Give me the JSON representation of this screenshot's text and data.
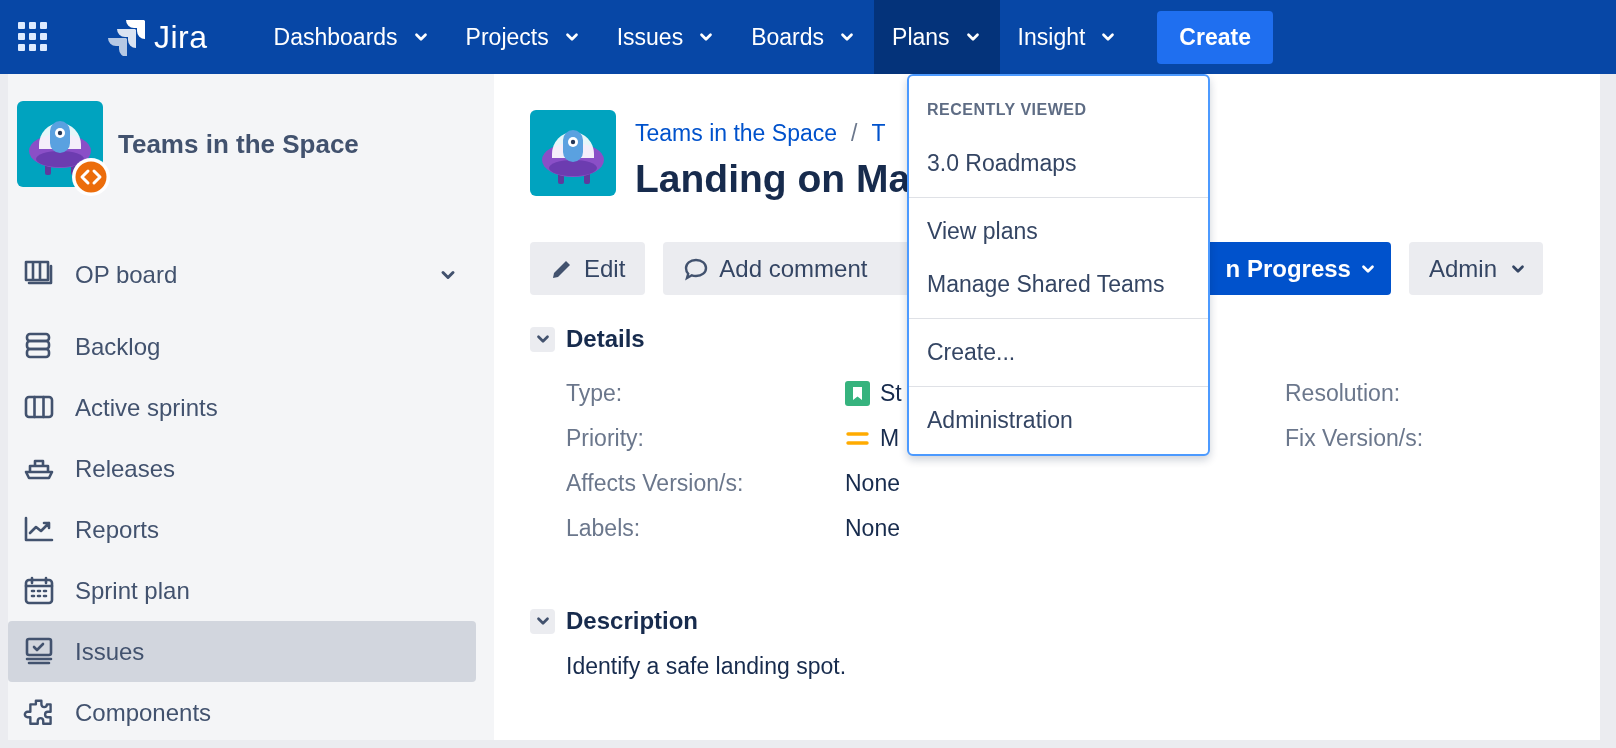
{
  "top_nav": {
    "logo_text": "Jira",
    "items": [
      {
        "label": "Dashboards",
        "selected": false
      },
      {
        "label": "Projects",
        "selected": false
      },
      {
        "label": "Issues",
        "selected": false
      },
      {
        "label": "Boards",
        "selected": false
      },
      {
        "label": "Plans",
        "selected": true
      },
      {
        "label": "Insight",
        "selected": false
      }
    ],
    "create_button": "Create"
  },
  "sidebar": {
    "project_name": "Teams in the Space",
    "items": [
      {
        "label": "OP board",
        "kind": "board",
        "selected": false
      },
      {
        "label": "Backlog",
        "kind": "backlog",
        "selected": false
      },
      {
        "label": "Active sprints",
        "kind": "sprints",
        "selected": false
      },
      {
        "label": "Releases",
        "kind": "releases",
        "selected": false
      },
      {
        "label": "Reports",
        "kind": "reports",
        "selected": false
      },
      {
        "label": "Sprint plan",
        "kind": "calendar",
        "selected": false
      },
      {
        "label": "Issues",
        "kind": "issues",
        "selected": true
      },
      {
        "label": "Components",
        "kind": "components",
        "selected": false
      }
    ]
  },
  "issue": {
    "breadcrumbs": [
      "Teams in the Space",
      "T"
    ],
    "breadcrumb_separator": "/",
    "title": "Landing on Ma",
    "actions": [
      {
        "label": "Edit",
        "kind": "edit"
      },
      {
        "label": "Add comment",
        "kind": "comment"
      },
      {
        "label": "n Progress",
        "kind": "status"
      },
      {
        "label": "Admin",
        "kind": "menu"
      }
    ],
    "details": {
      "heading": "Details",
      "expanded": true,
      "fields": [
        {
          "label": "Type:",
          "value": "St",
          "kind": "story"
        },
        {
          "label": "Priority:",
          "value": "M",
          "kind": "priority"
        },
        {
          "label": "Affects Version/s:",
          "value": "None",
          "kind": "text"
        },
        {
          "label": "Labels:",
          "value": "None",
          "kind": "text"
        }
      ],
      "right_fields": [
        {
          "label": "Resolution:"
        },
        {
          "label": "Fix Version/s:"
        }
      ]
    },
    "description": {
      "heading": "Description",
      "expanded": true,
      "text": "Identify a safe landing spot."
    }
  },
  "plans_menu": {
    "sections": [
      {
        "heading": "RECENTLY VIEWED",
        "items": [
          "3.0 Roadmaps"
        ]
      },
      {
        "items": [
          "View plans",
          "Manage Shared Teams"
        ]
      },
      {
        "items": [
          "Create..."
        ]
      },
      {
        "items": [
          "Administration"
        ]
      }
    ]
  }
}
